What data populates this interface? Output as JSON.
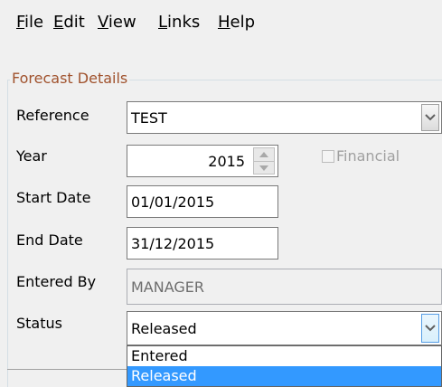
{
  "menu": [
    {
      "mnemonic": "F",
      "rest": "ile"
    },
    {
      "mnemonic": "E",
      "rest": "dit"
    },
    {
      "mnemonic": "V",
      "rest": "iew"
    },
    {
      "mnemonic": "L",
      "rest": "inks"
    },
    {
      "mnemonic": "H",
      "rest": "elp"
    }
  ],
  "group": {
    "title": "Forecast Details"
  },
  "fields": {
    "reference": {
      "label": "Reference",
      "value": "TEST"
    },
    "year": {
      "label": "Year",
      "value": "2015"
    },
    "financial": {
      "label": "Financial",
      "checked": false
    },
    "start_date": {
      "label": "Start Date",
      "value": "01/01/2015"
    },
    "end_date": {
      "label": "End Date",
      "value": "31/12/2015"
    },
    "entered_by": {
      "label": "Entered By",
      "value": "MANAGER"
    },
    "status": {
      "label": "Status",
      "value": "Released"
    }
  },
  "status_options": [
    "Entered",
    "Released"
  ],
  "selected_option": "Released",
  "colors": {
    "group_title": "#a0522d",
    "selection": "#3399ff"
  }
}
